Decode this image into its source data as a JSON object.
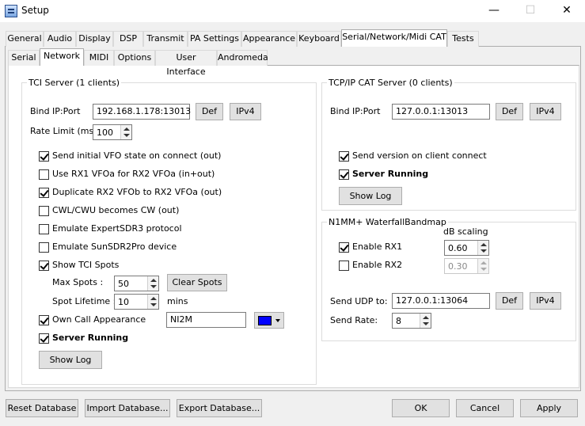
{
  "window": {
    "title": "Setup",
    "min_glyph": "—",
    "max_glyph": "☐",
    "close_glyph": "✕"
  },
  "tabs_top": [
    {
      "label": "General"
    },
    {
      "label": "Audio"
    },
    {
      "label": "Display"
    },
    {
      "label": "DSP"
    },
    {
      "label": "Transmit"
    },
    {
      "label": "PA Settings"
    },
    {
      "label": "Appearance"
    },
    {
      "label": "Keyboard"
    },
    {
      "label": "Serial/Network/Midi CAT"
    },
    {
      "label": "Tests"
    }
  ],
  "tabs_sub": [
    {
      "label": "Serial"
    },
    {
      "label": "Network"
    },
    {
      "label": "MIDI"
    },
    {
      "label": "Options"
    },
    {
      "label": "User Interface"
    },
    {
      "label": "Andromeda"
    }
  ],
  "tci": {
    "title": "TCI Server (1 clients)",
    "bind_label": "Bind IP:Port",
    "bind_value": "192.168.1.178:13013",
    "def_label": "Def",
    "ipv4_label": "IPv4",
    "rate_label": "Rate Limit (ms)",
    "rate_value": "100",
    "options": [
      {
        "label": "Send initial VFO state on connect (out)",
        "checked": true
      },
      {
        "label": "Use RX1 VFOa for RX2 VFOa (in+out)",
        "checked": false
      },
      {
        "label": "Duplicate RX2 VFOb to RX2 VFOa (out)",
        "checked": true
      },
      {
        "label": "CWL/CWU becomes CW (out)",
        "checked": false
      },
      {
        "label": "Emulate ExpertSDR3 protocol",
        "checked": false
      },
      {
        "label": "Emulate SunSDR2Pro device",
        "checked": false
      },
      {
        "label": "Show TCI Spots",
        "checked": true
      }
    ],
    "max_spots_label": "Max Spots :",
    "max_spots_value": "50",
    "clear_spots_label": "Clear Spots",
    "lifetime_label": "Spot Lifetime :",
    "lifetime_value": "10",
    "lifetime_unit": "mins",
    "own_call_label": "Own Call Appearance",
    "own_call_value": "NI2M",
    "own_call_color": "#0000ff",
    "server_running_label": "Server Running",
    "show_log_label": "Show Log"
  },
  "cat": {
    "title": "TCP/IP CAT Server (0 clients)",
    "bind_label": "Bind IP:Port",
    "bind_value": "127.0.0.1:13013",
    "def_label": "Def",
    "ipv4_label": "IPv4",
    "send_version_label": "Send version on client connect",
    "server_running_label": "Server Running",
    "show_log_label": "Show Log"
  },
  "n1mm": {
    "title": "N1MM+ WaterfallBandmap",
    "db_label": "dB scaling",
    "rx1_label": "Enable RX1",
    "rx1_value": "0.60",
    "rx2_label": "Enable RX2",
    "rx2_value": "0.30",
    "udp_label": "Send UDP to:",
    "udp_value": "127.0.0.1:13064",
    "def_label": "Def",
    "ipv4_label": "IPv4",
    "rate_label": "Send Rate:",
    "rate_value": "8"
  },
  "footer": {
    "reset_label": "Reset Database",
    "import_label": "Import Database...",
    "export_label": "Export Database...",
    "ok_label": "OK",
    "cancel_label": "Cancel",
    "apply_label": "Apply"
  }
}
